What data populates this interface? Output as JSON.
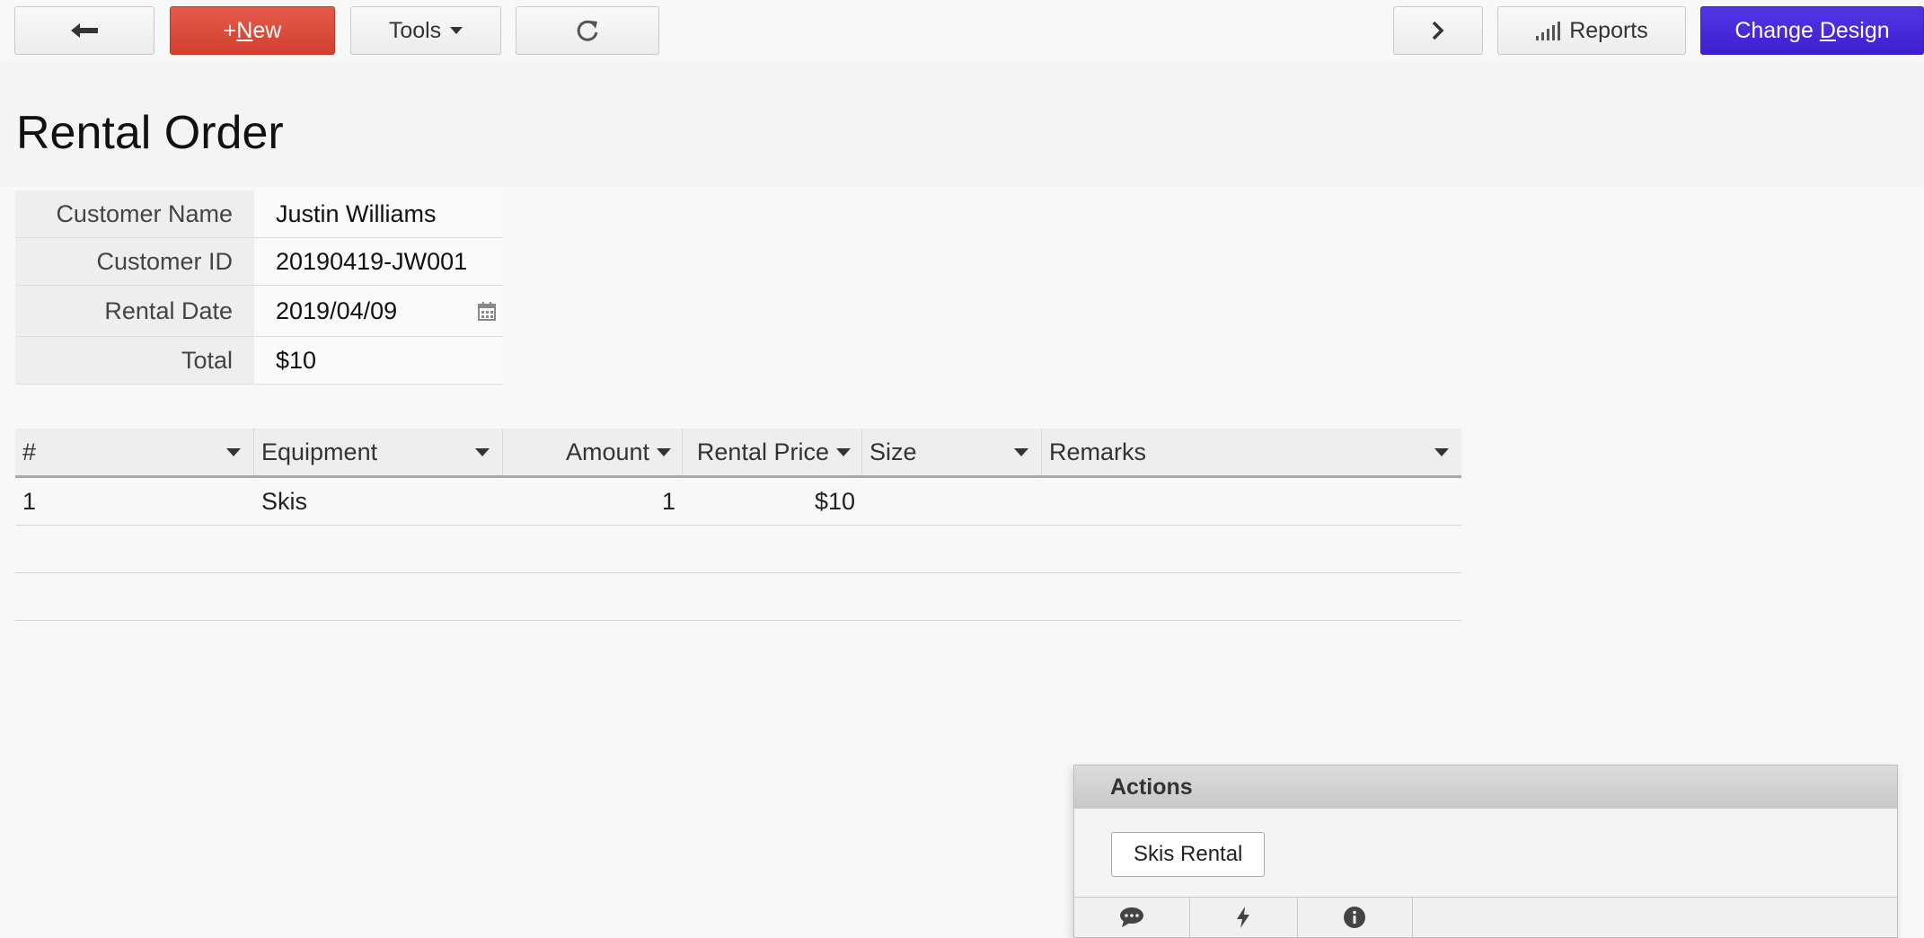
{
  "toolbar": {
    "back_label": "←",
    "new_prefix": "+",
    "new_accel": "N",
    "new_rest": "ew",
    "tools_label": "Tools",
    "reports_label": "Reports",
    "design_prefix": "Change ",
    "design_accel": "D",
    "design_rest": "esign"
  },
  "page": {
    "title": "Rental Order"
  },
  "form": {
    "fields": [
      {
        "label": "Customer Name",
        "value": "Justin Williams"
      },
      {
        "label": "Customer ID",
        "value": "20190419-JW001"
      },
      {
        "label": "Rental Date",
        "value": "2019/04/09"
      },
      {
        "label": "Total",
        "value": "$10"
      }
    ]
  },
  "grid": {
    "headers": [
      "#",
      "Equipment",
      "Amount",
      "Rental Price",
      "Size",
      "Remarks"
    ],
    "rows": [
      [
        "1",
        "Skis",
        "1",
        "$10",
        "",
        ""
      ],
      [
        "",
        "",
        "",
        "",
        "",
        ""
      ],
      [
        "",
        "",
        "",
        "",
        "",
        ""
      ]
    ]
  },
  "actions": {
    "title": "Actions",
    "buttons": [
      "Skis Rental"
    ]
  },
  "colors": {
    "new_button": "#d94838",
    "design_button": "#4628d8"
  }
}
